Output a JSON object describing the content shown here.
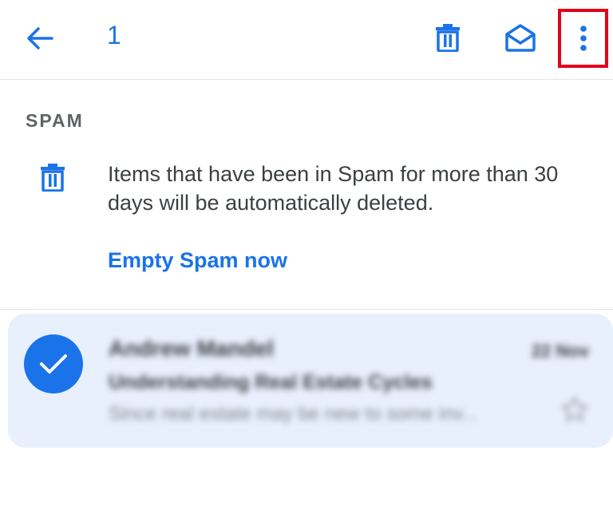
{
  "toolbar": {
    "selected_count": "1",
    "back_icon": "arrow-back-icon",
    "delete_icon": "trash-icon",
    "mark_read_icon": "envelope-open-icon",
    "more_icon": "more-vert-icon",
    "highlight_color": "#e2001a"
  },
  "banner": {
    "section_label": "SPAM",
    "icon": "trash-icon",
    "message": "Items that have been in Spam for more than 30 days will be automatically deleted.",
    "action_label": "Empty Spam now"
  },
  "messages": [
    {
      "selected": true,
      "sender": "Andrew Mandel",
      "date": "22 Nov",
      "subject": "Understanding Real Estate Cycles",
      "snippet": "Since real estate may be new to some inv...",
      "starred": false
    }
  ],
  "colors": {
    "accent": "#1a73e8",
    "selected_row_bg": "#e8f0fe",
    "text_primary": "#3c4043",
    "text_secondary": "#5f6368"
  }
}
